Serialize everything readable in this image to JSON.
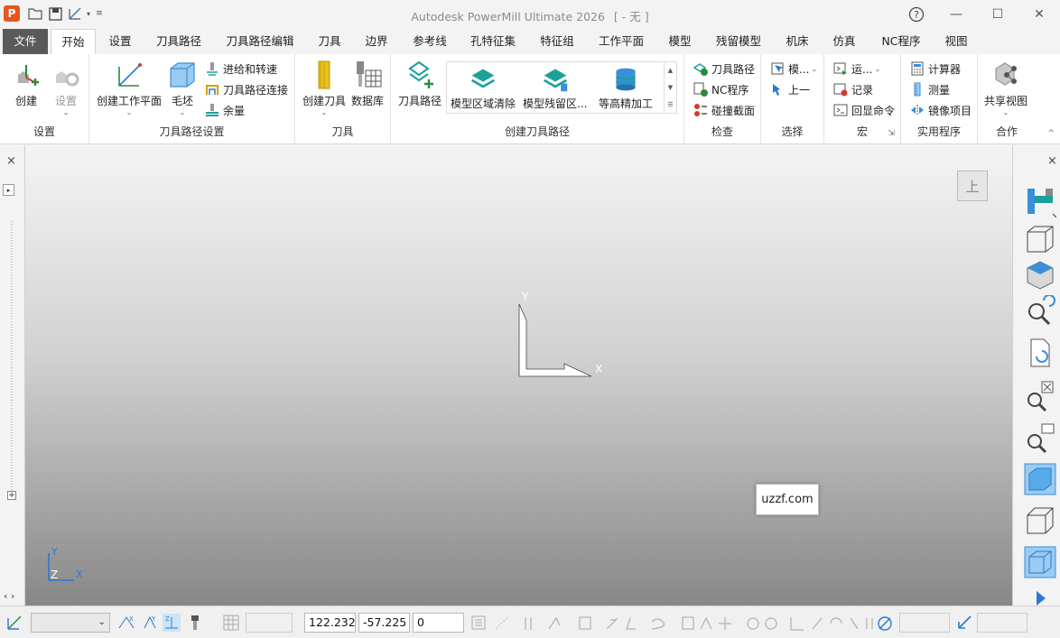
{
  "window": {
    "app_icon_letter": "P",
    "title": "Autodesk PowerMill Ultimate 2026",
    "project": "[ - 无 ]",
    "help_label": "?",
    "minimize": "—",
    "maximize": "☐",
    "close": "✕"
  },
  "menu_tabs": [
    "文件",
    "开始",
    "设置",
    "刀具路径",
    "刀具路径编辑",
    "刀具",
    "边界",
    "参考线",
    "孔特征集",
    "特征组",
    "工作平面",
    "模型",
    "残留模型",
    "机床",
    "仿真",
    "NC程序",
    "视图"
  ],
  "active_tab": "开始",
  "ribbon": {
    "setup_group": {
      "label": "设置",
      "create": "创建",
      "settings": "设置"
    },
    "toolpath_setup_group": {
      "label": "刀具路径设置",
      "create_workplane": "创建工作平面",
      "stock": "毛坯",
      "feeds_rapids": "进给和转速",
      "toolpath_connections": "刀具路径连接",
      "thickness": "余量"
    },
    "tool_group": {
      "label": "刀具",
      "create_tool": "创建刀具",
      "database": "数据库"
    },
    "create_toolpath_group": {
      "label": "创建刀具路径",
      "toolpaths": "刀具路径",
      "gallery": [
        "模型区域清除",
        "模型残留区...",
        "等高精加工"
      ]
    },
    "check_group": {
      "label": "检查",
      "toolpath": "刀具路径",
      "nc_program": "NC程序",
      "collision_section": "碰撞截面"
    },
    "select_group": {
      "label": "选择",
      "model": "模...",
      "previous": "上一"
    },
    "macro_group": {
      "label": "宏",
      "run": "运...",
      "record": "记录",
      "echo": "回显命令"
    },
    "utilities_group": {
      "label": "实用程序",
      "calculator": "计算器",
      "measure": "测量",
      "mirror": "镜像项目"
    },
    "collab_group": {
      "label": "合作",
      "shared_views": "共享视图"
    }
  },
  "viewport": {
    "view_cube_label": "上",
    "axis_y": "Y",
    "axis_x": "X",
    "mini_axis_y": "Y",
    "mini_axis_z": "Z",
    "mini_axis_x": "X",
    "watermark": "uzzf.com"
  },
  "panels": {
    "left_close": "×",
    "right_close": "×",
    "left_toggle": "‹ ›"
  },
  "statusbar": {
    "coord_x": "122.232",
    "coord_y": "-57.225",
    "coord_z": "0"
  },
  "colors": {
    "accent_blue": "#3a8fd9",
    "teal": "#1aa29a",
    "file_tab": "#5a5a5a"
  }
}
